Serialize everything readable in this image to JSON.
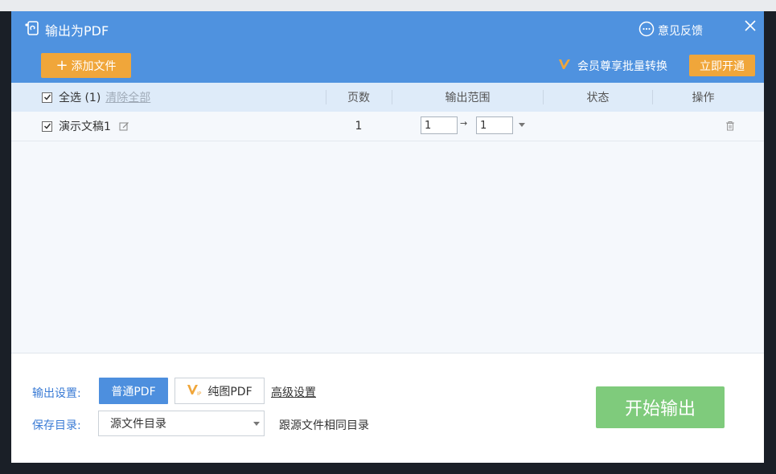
{
  "dialog": {
    "title": "输出为PDF",
    "feedback_label": "意见反馈",
    "add_file_label": "添加文件",
    "vip_promo": "会员尊享批量转换",
    "vip_open_label": "立即开通"
  },
  "table": {
    "select_all_label": "全选 (1)",
    "clear_all_label": "清除全部",
    "columns": {
      "pages": "页数",
      "range": "输出范围",
      "status": "状态",
      "action": "操作"
    },
    "rows": [
      {
        "name": "演示文稿1",
        "pages": "1",
        "range_from": "1",
        "range_to": "1",
        "checked": true
      }
    ]
  },
  "footer": {
    "output_settings_label": "输出设置:",
    "normal_pdf_label": "普通PDF",
    "pure_image_pdf_label": "纯图PDF",
    "advanced_settings_label": "高级设置",
    "save_dir_label": "保存目录:",
    "save_dir_value": "源文件目录",
    "save_dir_note": "跟源文件相同目录",
    "start_label": "开始输出"
  },
  "colors": {
    "header": "#4f92df",
    "accent_orange": "#f0a63a",
    "start_green": "#7fcb7c",
    "label_blue": "#3a7bd5"
  }
}
